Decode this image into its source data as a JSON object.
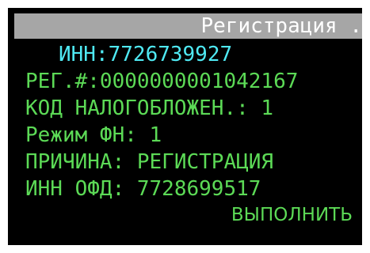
{
  "header": {
    "title": "Регистрация ."
  },
  "fields": {
    "inn": "ИНН:7726739927",
    "reg_number": "РЕГ.#:0000000001042167",
    "tax_code": "КОД НАЛОГОБЛОЖЕН.: 1",
    "fn_mode": "Режим ФН: 1",
    "reason": "ПРИЧИНА: РЕГИСТРАЦИЯ",
    "ofd_inn": "ИНН ОФД: 7728699517"
  },
  "actions": {
    "execute_label": "ВЫПОЛНИТЬ"
  },
  "colors": {
    "background": "#000000",
    "title_bar": "#a6a6a6",
    "title_text": "#ffffff",
    "inn_text": "#4fe9f3",
    "field_text": "#5cda56"
  }
}
